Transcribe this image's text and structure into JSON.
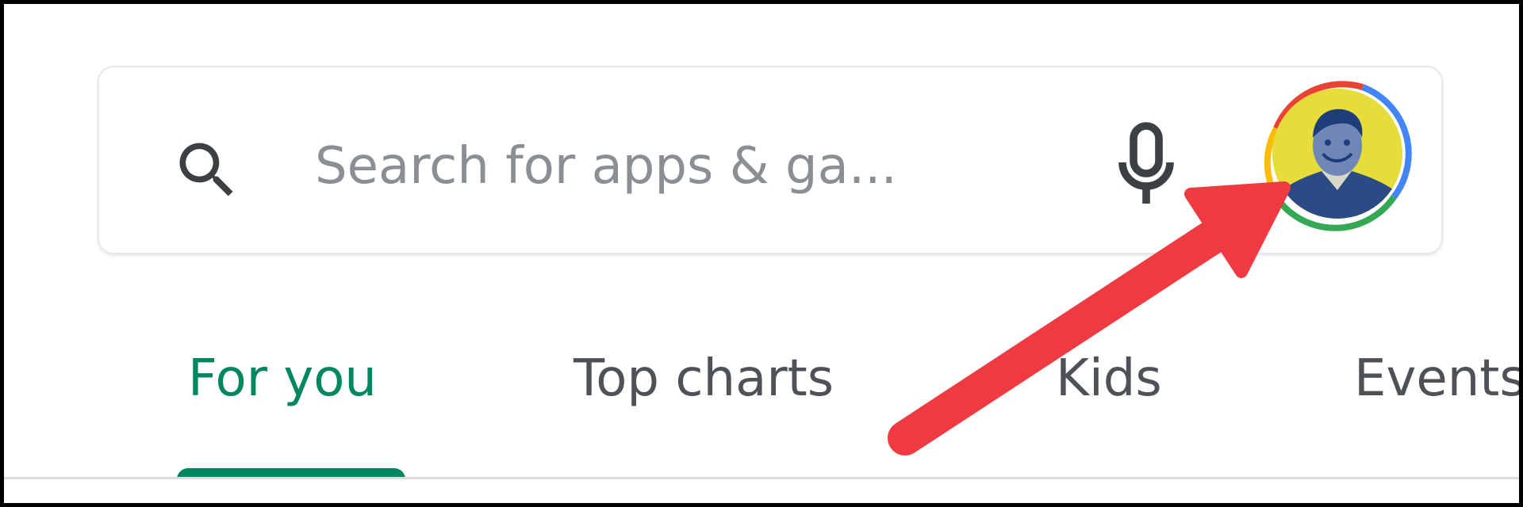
{
  "search": {
    "placeholder": "Search for apps & ga...",
    "icon": "search-icon",
    "mic_icon": "microphone-icon"
  },
  "account": {
    "avatar_icon": "profile-avatar",
    "ring_colors": [
      "#ea4335",
      "#4285f4",
      "#34a853",
      "#fbbc05"
    ]
  },
  "tabs": [
    {
      "label": "For you",
      "active": true
    },
    {
      "label": "Top charts",
      "active": false
    },
    {
      "label": "Kids",
      "active": false
    },
    {
      "label": "Events",
      "active": false
    }
  ],
  "colors": {
    "accent": "#01875f",
    "tab_text": "#4e5256",
    "placeholder": "#8a8f94",
    "annotation_arrow": "#f03a42"
  }
}
